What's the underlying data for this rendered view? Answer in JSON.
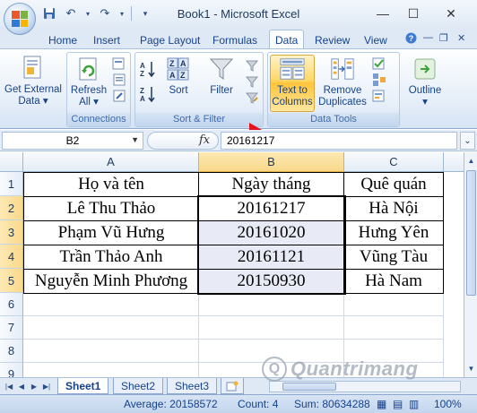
{
  "window": {
    "title": "Book1 - Microsoft Excel",
    "minimize": "—",
    "maximize": "☐",
    "close": "✕"
  },
  "qat": {
    "save_icon": "save-icon",
    "undo_icon": "undo-icon",
    "redo_icon": "redo-icon"
  },
  "tabs": [
    {
      "label": "Home"
    },
    {
      "label": "Insert"
    },
    {
      "label": "Page Layout"
    },
    {
      "label": "Formulas"
    },
    {
      "label": "Data"
    },
    {
      "label": "Review"
    },
    {
      "label": "View"
    }
  ],
  "active_tab": "Data",
  "ribbon": {
    "get_external_data": {
      "line1": "Get External",
      "line2": "Data ▾"
    },
    "refresh_all": {
      "line1": "Refresh",
      "line2": "All ▾"
    },
    "connections_label": "Connections",
    "sort": "Sort",
    "filter": "Filter",
    "sort_filter_label": "Sort & Filter",
    "text_to_columns": {
      "line1": "Text to",
      "line2": "Columns"
    },
    "remove_duplicates": {
      "line1": "Remove",
      "line2": "Duplicates"
    },
    "data_tools_label": "Data Tools",
    "outline": {
      "line1": "Outline",
      "line2": "▾"
    }
  },
  "formula_bar": {
    "name_box": "B2",
    "fx": "fx",
    "value": "20161217"
  },
  "columns": [
    "A",
    "B",
    "C"
  ],
  "rows": [
    "1",
    "2",
    "3",
    "4",
    "5",
    "6",
    "7",
    "8",
    "9"
  ],
  "table": {
    "header": [
      "Họ và tên",
      "Ngày tháng",
      "Quê quán"
    ],
    "data": [
      [
        "Lê Thu Thảo",
        "20161217",
        "Hà Nội"
      ],
      [
        "Phạm Vũ Hưng",
        "20161020",
        "Hưng Yên"
      ],
      [
        "Trần Thảo Anh",
        "20161121",
        "Vũng Tàu"
      ],
      [
        "Nguyễn Minh Phương",
        "20150930",
        "Hà Nam"
      ]
    ]
  },
  "sheets": [
    "Sheet1",
    "Sheet2",
    "Sheet3"
  ],
  "active_sheet": "Sheet1",
  "status": {
    "average": "Average: 20158572",
    "count": "Count: 4",
    "sum": "Sum: 80634288",
    "zoom": "100%"
  },
  "watermark": "Quantrimang"
}
